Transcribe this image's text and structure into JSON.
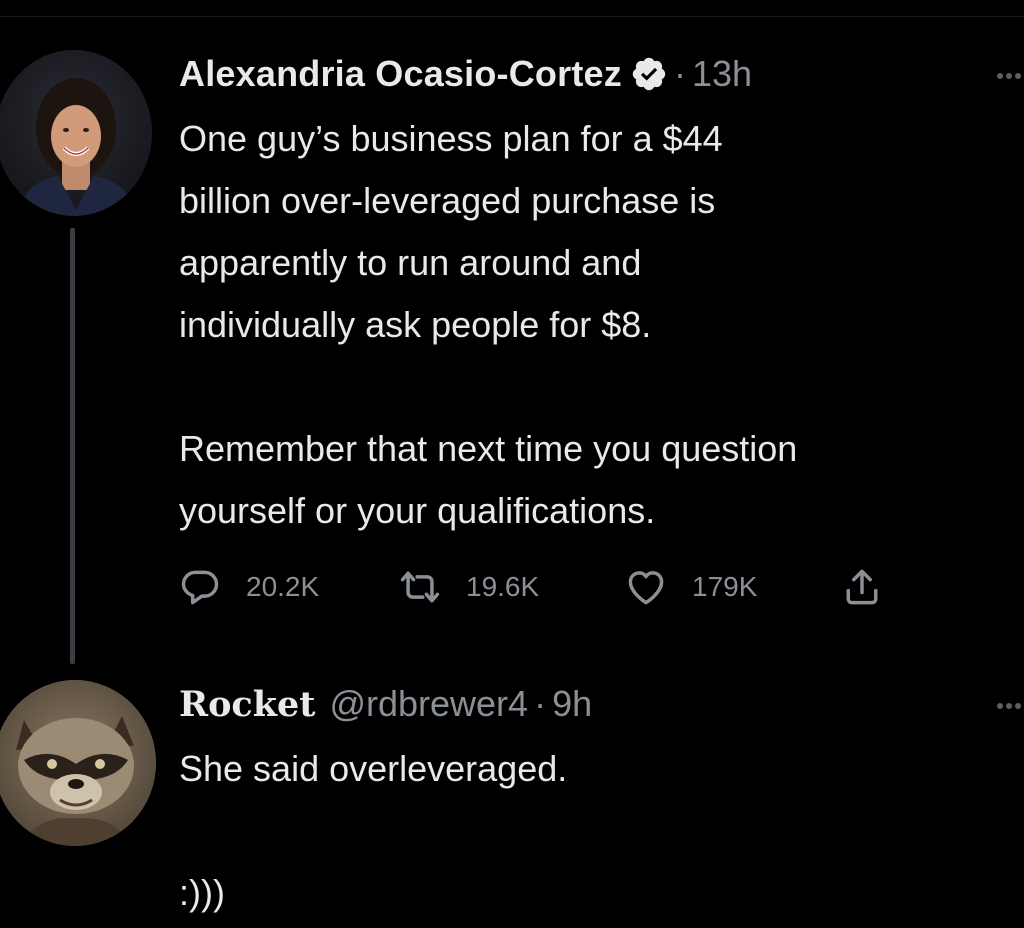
{
  "tweets": [
    {
      "author_name": "Alexandria Ocasio-Cortez",
      "verified": true,
      "separator": "·",
      "time": "13h",
      "text": "One guy’s business plan for a $44\nbillion over-leveraged purchase is\napparently to run around and\nindividually ask people for $8.\n\nRemember that next time you question\nyourself or your qualifications.",
      "actions": {
        "reply_count": "20.2K",
        "retweet_count": "19.6K",
        "like_count": "179K"
      }
    },
    {
      "author_name": "Rocket",
      "handle": "@rdbrewer4",
      "separator": "·",
      "time": "9h",
      "text": "She said overleveraged.\n\n:)))"
    }
  ],
  "colors": {
    "background": "#000000",
    "text_primary": "#e7e9ea",
    "text_secondary": "#8b9096",
    "thread_line": "#3b3f43"
  },
  "icons": {
    "verified": "verified-badge-icon",
    "more": "more-options-icon",
    "reply": "reply-bubble-icon",
    "retweet": "retweet-icon",
    "like": "heart-icon",
    "share": "share-icon"
  }
}
